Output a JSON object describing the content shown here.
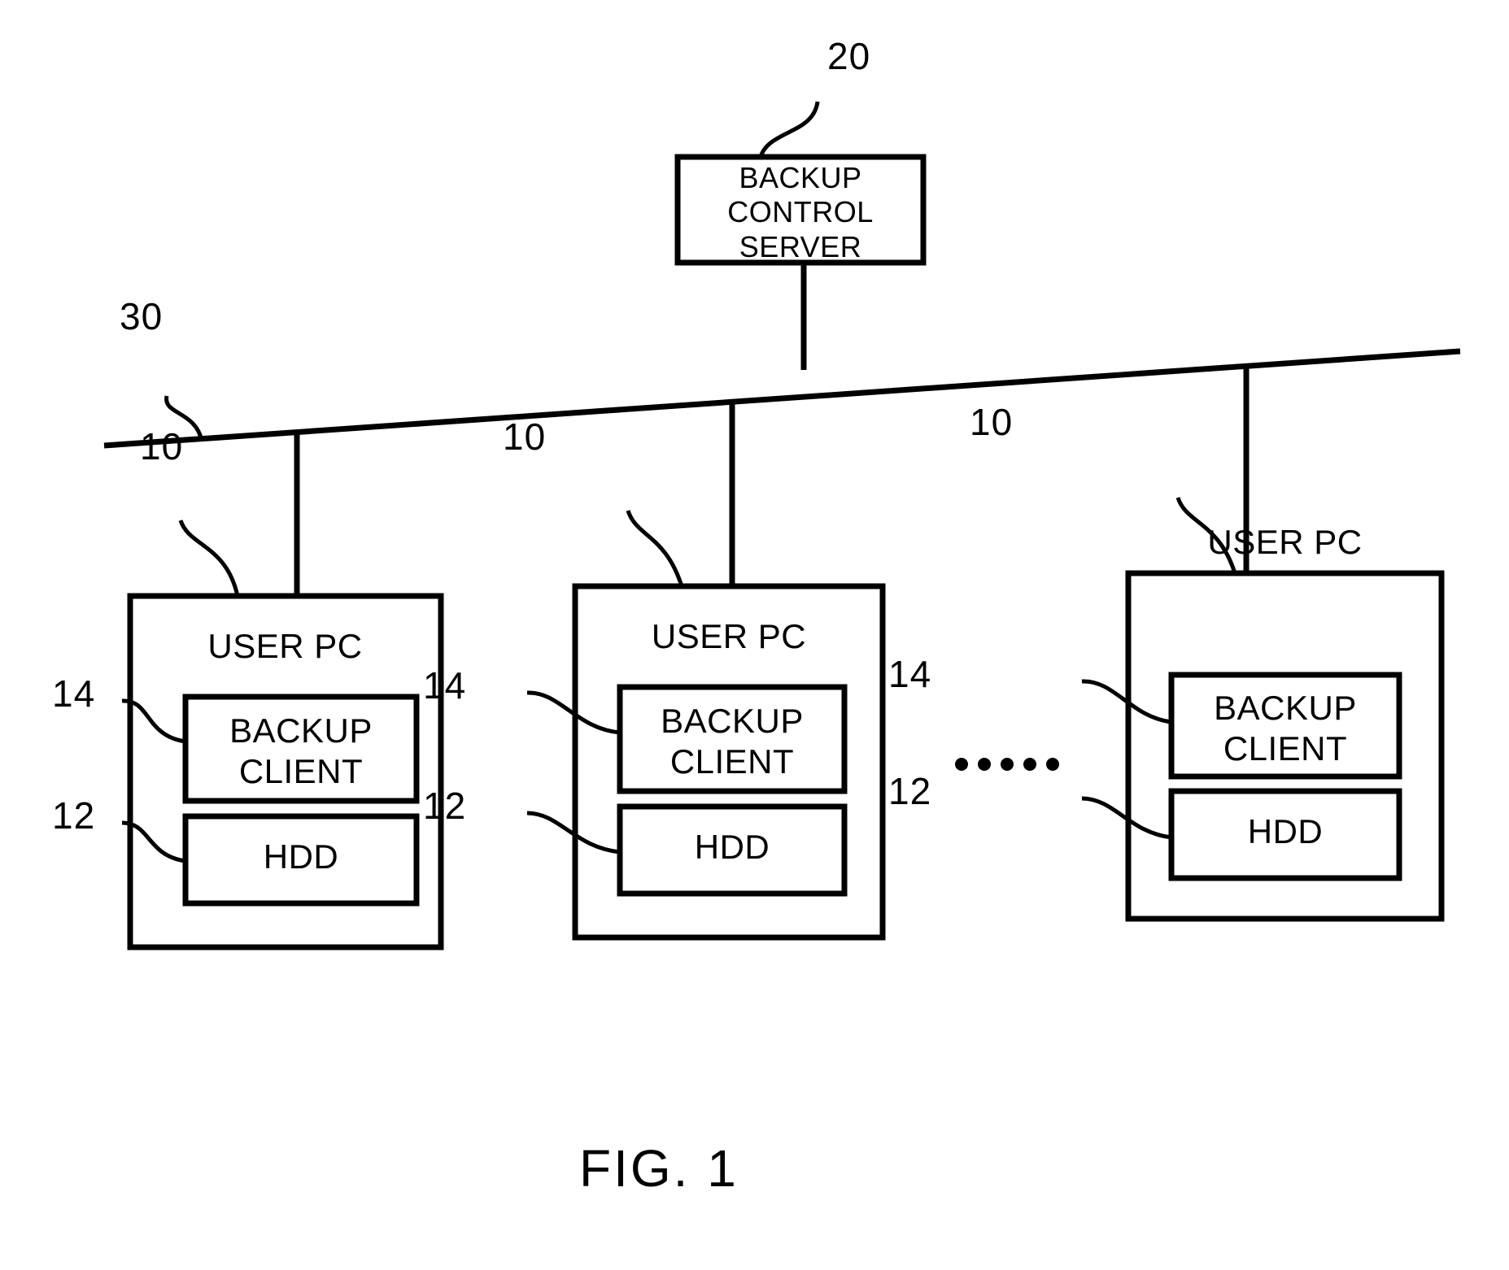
{
  "figure": {
    "caption": "FIG. 1",
    "title_number": "1"
  },
  "server": {
    "label": "BACKUP\nCONTROL\nSERVER",
    "ref": "20"
  },
  "network": {
    "ref": "30",
    "name": "network-bus"
  },
  "ellipsis": {
    "text": "• • • • •"
  },
  "nodes": [
    {
      "title": "USER PC",
      "ref": "10",
      "client": {
        "label": "BACKUP\nCLIENT",
        "ref": "14"
      },
      "hdd": {
        "label": "HDD",
        "ref": "12"
      }
    },
    {
      "title": "USER PC",
      "ref": "10",
      "client": {
        "label": "BACKUP\nCLIENT",
        "ref": "14"
      },
      "hdd": {
        "label": "HDD",
        "ref": "12"
      }
    },
    {
      "title": "USER PC",
      "ref": "10",
      "client": {
        "label": "BACKUP\nCLIENT",
        "ref": "14"
      },
      "hdd": {
        "label": "HDD",
        "ref": "12"
      }
    }
  ],
  "colors": {
    "ink": "#000000",
    "paper": "#ffffff"
  }
}
